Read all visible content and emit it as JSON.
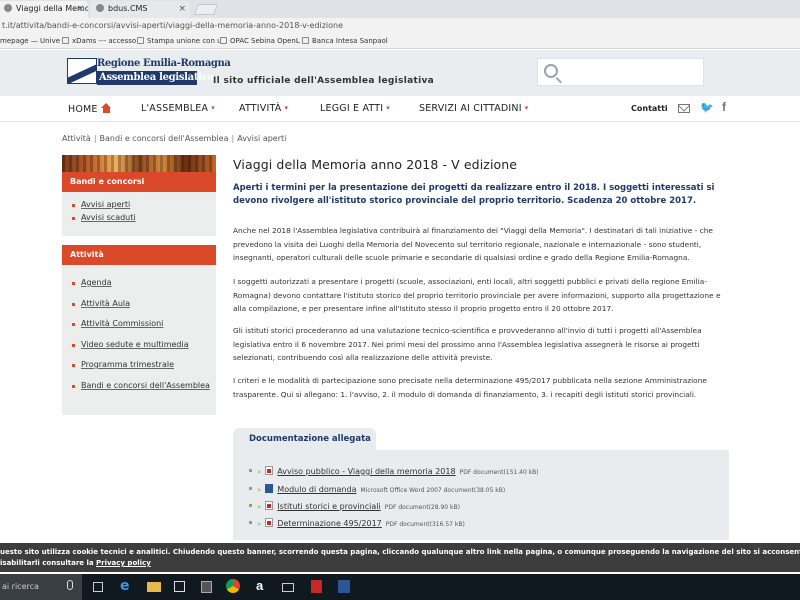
{
  "browser": {
    "tabs": [
      {
        "label": "Viaggi della Memoria anr",
        "active": true
      },
      {
        "label": "bdus.CMS",
        "active": false
      }
    ],
    "address": "t.it/attivita/bandi-e-concorsi/avvisi-aperti/viaggi-della-memoria-anno-2018-v-edizione",
    "bookmarks": [
      "mepage — Unive",
      "xDams --- accesso",
      "Stampa unione con u",
      "OPAC Sebina OpenL",
      "Banca Intesa Sanpaol"
    ]
  },
  "header": {
    "logo_line1": "Regione Emilia-Romagna",
    "logo_line2": "Assemblea legislativa",
    "tagline": "Il sito ufficiale dell'Assemblea legislativa",
    "search_placeholder": ""
  },
  "nav": {
    "items": [
      "HOME",
      "L'ASSEMBLEA",
      "ATTIVITÀ",
      "LEGGI E ATTI",
      "SERVIZI AI CITTADINI"
    ],
    "contatti": "Contatti"
  },
  "breadcrumb": [
    "Attività",
    "Bandi e concorsi dell'Assemblea",
    "Avvisi aperti"
  ],
  "sidebar": {
    "section1": {
      "title": "Bandi e concorsi",
      "items": [
        "Avvisi aperti",
        "Avvisi scaduti"
      ]
    },
    "section2": {
      "title": "Attività",
      "items": [
        "Agenda",
        "Attività Aula",
        "Attività Commissioni",
        "Video sedute e multimedia",
        "Programma trimestrale",
        "Bandi e concorsi dell'Assemblea"
      ]
    }
  },
  "main": {
    "title": "Viaggi della Memoria anno 2018 - V edizione",
    "lead": "Aperti i termini per la presentazione dei progetti da realizzare entro il 2018. I soggetti interessati si devono rivolgere all'istituto storico provinciale del proprio territorio. Scadenza 20 ottobre 2017.",
    "paragraphs": [
      "Anche nel 2018 l'Assemblea legislativa contribuirà al finanziamento dei \"Viaggi della Memoria\". I destinatari di tali iniziative - che prevedono la visita dei Luoghi della Memoria del Novecento sul territorio regionale, nazionale e internazionale - sono studenti, insegnanti, operatori culturali delle scuole primarie e secondarie di qualsiasi ordine e grado della Regione Emilia-Romagna.",
      "I soggetti autorizzati a presentare i progetti (scuole, associazioni, enti locali, altri soggetti pubblici e privati della regione Emilia-Romagna) devono contattare l'istituto storico del proprio territorio provinciale per avere informazioni, supporto alla progettazione e alla compilazione, e per presentare infine all'Istituto stesso il proprio progetto entro il 20 ottobre 2017.",
      "Gli istituti storici procederanno ad una valutazione tecnico-scientifica e provvederanno all'invio di tutti i progetti all'Assemblea legislativa entro il 6 novembre 2017. Nei primi mesi del prossimo anno l'Assemblea legislativa assegnerà le risorse ai progetti selezionati, contribuendo così alla realizzazione delle attività previste.",
      "I criteri e le modalità di partecipazione sono precisate nella determinazione 495/2017 pubblicata nella sezione Amministrazione trasparente. Qui si allegano: 1. l'avviso, 2. il modulo di domanda di finanziamento, 3. i recapiti degli istituti storici provinciali."
    ]
  },
  "documents": {
    "title": "Documentazione allegata",
    "items": [
      {
        "name": "Avviso pubblico - Viaggi della memoria 2018",
        "type": "pdf",
        "meta": "PDF document(151.40 kB)"
      },
      {
        "name": "Modulo di domanda",
        "type": "word",
        "meta": "Microsoft Office Word 2007 document(38.05 kB)"
      },
      {
        "name": "Istituti storici e provinciali",
        "type": "pdf",
        "meta": "PDF document(28.90 kB)"
      },
      {
        "name": "Determinazione 495/2017",
        "type": "pdf",
        "meta": "PDF document(316.57 kB)"
      }
    ]
  },
  "cookie": {
    "line1": "uesto sito utilizza cookie tecnici e analitici. Chiudendo questo banner, scorrendo questa pagina, cliccando qualunque altro link nella pagina, o comunque proseguendo la navigazione del sito si acconsente all'uso dei cookie. Per maggiori info",
    "line2_prefix": "isabilitarli consultare la ",
    "link": "Privacy policy"
  },
  "taskbar": {
    "search_text": "ai ricerca"
  },
  "colors": {
    "accent": "#d9492a",
    "brand": "#1f3a6a",
    "sidebar_bg": "#eceeee",
    "doc_bullet": "#7ab648"
  }
}
